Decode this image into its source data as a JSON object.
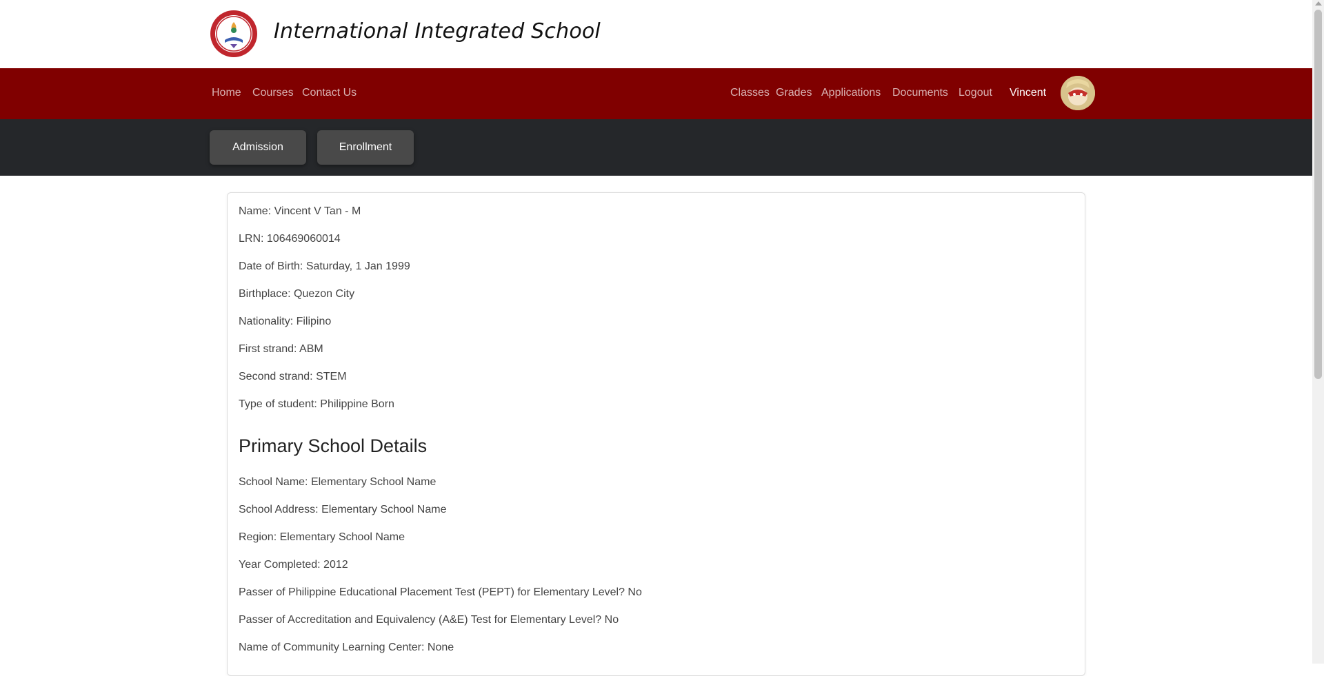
{
  "site": {
    "title": "International Integrated School"
  },
  "nav": {
    "left": [
      "Home",
      "Courses",
      "Contact Us"
    ],
    "right": [
      "Classes",
      "Grades",
      "Applications",
      "Documents",
      "Logout"
    ],
    "user": "Vincent"
  },
  "subnav": [
    "Admission",
    "Enrollment"
  ],
  "profile": {
    "name": "Name: Vincent V Tan - M",
    "lrn": "LRN: 106469060014",
    "dob": "Date of Birth: Saturday, 1 Jan 1999",
    "birthplace": "Birthplace: Quezon City",
    "nationality": "Nationality: Filipino",
    "first_strand": "First strand: ABM",
    "second_strand": "Second strand: STEM",
    "type": "Type of student: Philippine Born"
  },
  "primary": {
    "heading": "Primary School Details",
    "school_name": "School Name: Elementary School Name",
    "school_address": "School Address: Elementary School Name",
    "region": "Region: Elementary School Name",
    "year_completed": "Year Completed: 2012",
    "pept": "Passer of Philippine Educational Placement Test (PEPT) for Elementary Level? No",
    "ae": "Passer of Accreditation and Equivalency (A&E) Test for Elementary Level? No",
    "clc": "Name of Community Learning Center: None"
  },
  "colors": {
    "brand": "#800000",
    "subbar": "#25272a",
    "button": "#494949"
  },
  "icons": {
    "logo": "school-seal-logo",
    "avatar": "user-avatar"
  }
}
